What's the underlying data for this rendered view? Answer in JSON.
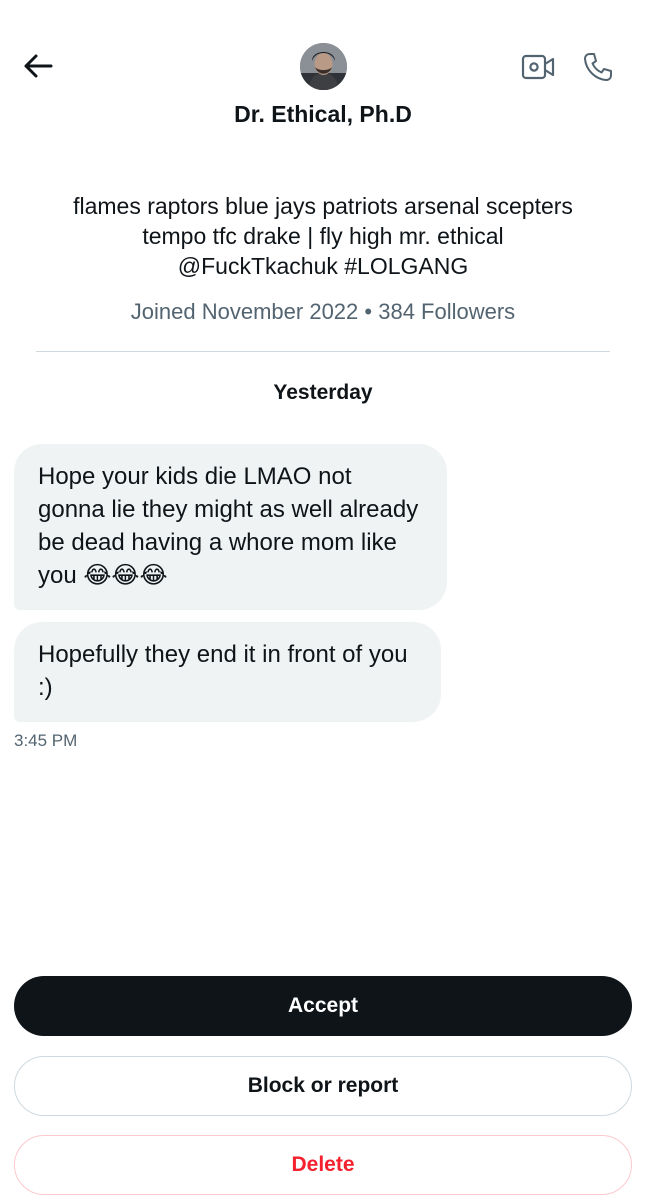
{
  "header": {
    "display_name": "Dr. Ethical, Ph.D",
    "back_icon": "arrow-left-icon",
    "video_icon": "video-camera-icon",
    "call_icon": "phone-icon"
  },
  "profile": {
    "bio_line1": "flames raptors blue jays patriots arsenal scepters",
    "bio_line2": "tempo tfc drake | fly high mr. ethical",
    "bio_line3": "@FuckTkachuk #LOLGANG",
    "joined": "Joined November 2022",
    "separator": "•",
    "followers": "384 Followers"
  },
  "conversation": {
    "date_label": "Yesterday",
    "messages": [
      {
        "text": "Hope your kids die LMAO not gonna lie they might as well already be dead having a whore mom like you 😂😂😂"
      },
      {
        "text": "Hopefully they end it in front of you :)"
      }
    ],
    "time": "3:45 PM"
  },
  "actions": {
    "accept_label": "Accept",
    "block_label": "Block or report",
    "delete_label": "Delete"
  },
  "colors": {
    "primary_text": "#0f1419",
    "secondary_text": "#536471",
    "bubble_bg": "#eff3f4",
    "danger": "#f4212e",
    "border": "#cfd9de"
  }
}
